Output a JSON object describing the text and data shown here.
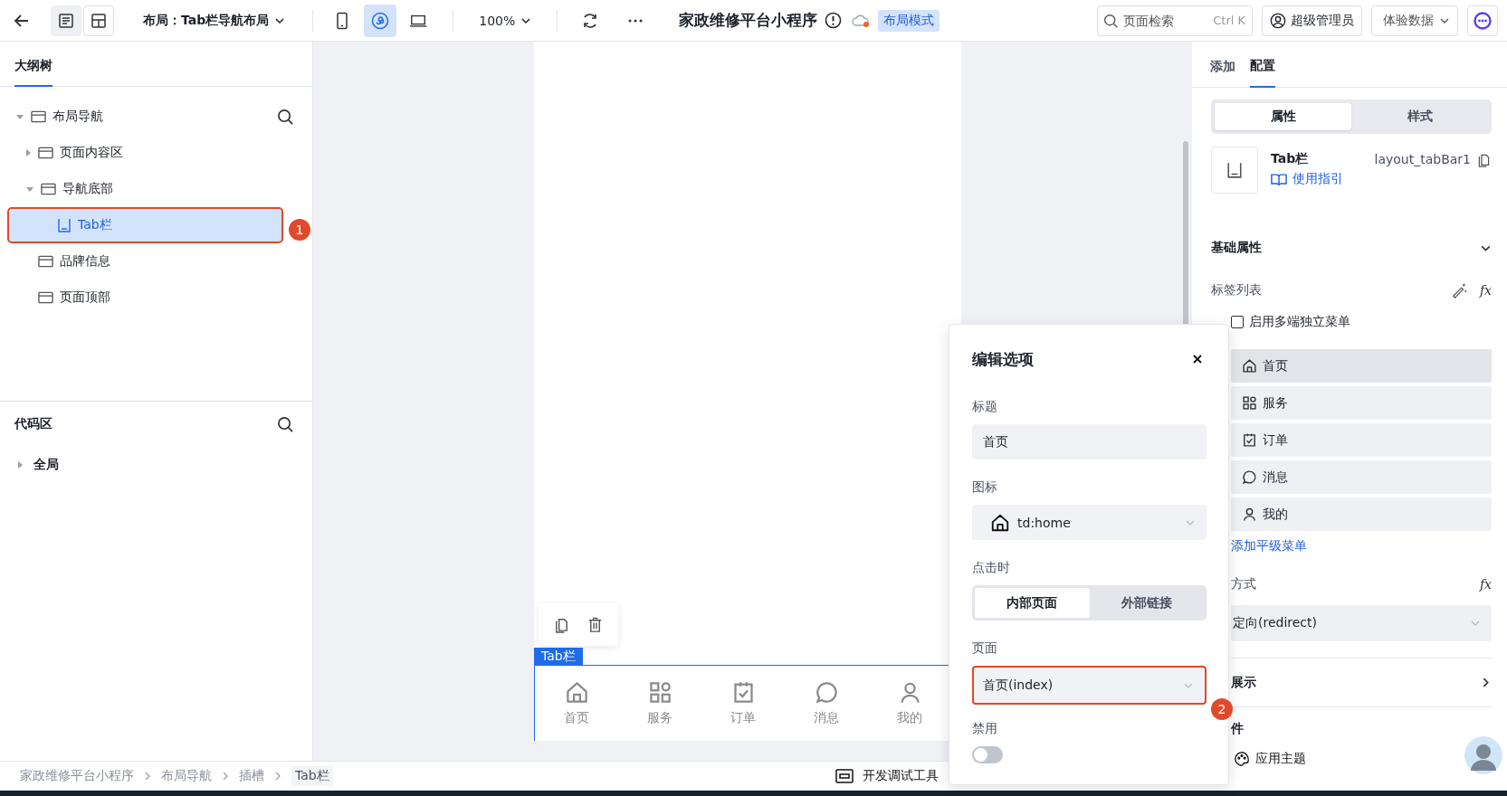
{
  "toolbar": {
    "layout_title": "布局：Tab栏导航布局",
    "view_modes": [
      {
        "kind": "phone",
        "selected": false
      },
      {
        "kind": "miniprogram",
        "selected": true
      },
      {
        "kind": "desktop",
        "selected": false
      }
    ],
    "zoom": "100%",
    "app_title": "家政维修平台小程序",
    "mode_badge": "布局模式",
    "search": {
      "placeholder": "页面检索",
      "shortcut": "Ctrl K"
    },
    "user": "超级管理员",
    "data_menu": "体验数据"
  },
  "outline": {
    "tab": "大纲树",
    "tree": [
      {
        "label": "布局导航",
        "kind": "container",
        "expanded": true,
        "selected": false,
        "children": [
          {
            "label": "页面内容区",
            "kind": "container",
            "expanded": false,
            "selected": false
          },
          {
            "label": "导航底部",
            "kind": "container",
            "expanded": true,
            "selected": false,
            "children": [
              {
                "label": "Tab栏",
                "kind": "tabbar",
                "selected": true,
                "callout": "1"
              }
            ]
          },
          {
            "label": "品牌信息",
            "kind": "container",
            "selected": false
          },
          {
            "label": "页面顶部",
            "kind": "container",
            "selected": false
          }
        ]
      }
    ]
  },
  "code_area": {
    "title": "代码区",
    "tree": [
      {
        "label": "全局",
        "expanded": false
      }
    ]
  },
  "canvas": {
    "tabbar_label": "Tab栏",
    "tabs": [
      {
        "label": "首页",
        "kind": "home"
      },
      {
        "label": "服务",
        "kind": "grid"
      },
      {
        "label": "订单",
        "kind": "order"
      },
      {
        "label": "消息",
        "kind": "chat"
      },
      {
        "label": "我的",
        "kind": "user"
      }
    ]
  },
  "breadcrumb": [
    "家政维修平台小程序",
    "布局导航",
    "插槽",
    "Tab栏"
  ],
  "debug_tools": "开发调试工具",
  "right_panel": {
    "tabs": [
      {
        "label": "添加",
        "selected": false
      },
      {
        "label": "配置",
        "selected": true
      }
    ],
    "segments": [
      {
        "label": "属性",
        "selected": true
      },
      {
        "label": "样式",
        "selected": false
      }
    ],
    "component": {
      "name": "Tab栏",
      "id": "layout_tabBar1",
      "guide_link": "使用指引"
    },
    "section": {
      "title": "基础属性",
      "expanded": true
    },
    "tab_list": {
      "label": "标签列表",
      "formula_button": "fx",
      "multi_menu": {
        "label": "启用多端独立菜单",
        "checked": false
      },
      "items": [
        {
          "label": "首页",
          "kind": "home",
          "selected": true
        },
        {
          "label": "服务",
          "kind": "grid",
          "selected": false
        },
        {
          "label": "订单",
          "kind": "order",
          "selected": false
        },
        {
          "label": "消息",
          "kind": "chat",
          "selected": false
        },
        {
          "label": "我的",
          "kind": "user",
          "selected": false
        }
      ],
      "add_link": "添加平级菜单"
    },
    "jump": {
      "label": "方式",
      "formula_button": "fx",
      "value": "定向(redirect)"
    },
    "sections": [
      {
        "title": "展示",
        "expanded": false
      },
      {
        "title": "件"
      }
    ],
    "theme_button": "应用主题"
  },
  "dialog": {
    "title": "编辑选项",
    "title_label": "标题",
    "title_value": "首页",
    "icon_label": "图标",
    "icon_value": "td:home",
    "click_label": "点击时",
    "click_options": [
      {
        "label": "内部页面",
        "selected": true
      },
      {
        "label": "外部链接",
        "selected": false
      }
    ],
    "page_label": "页面",
    "page_value": "首页(index)",
    "page_callout": "2",
    "disabled_label": "禁用",
    "disabled": false
  }
}
